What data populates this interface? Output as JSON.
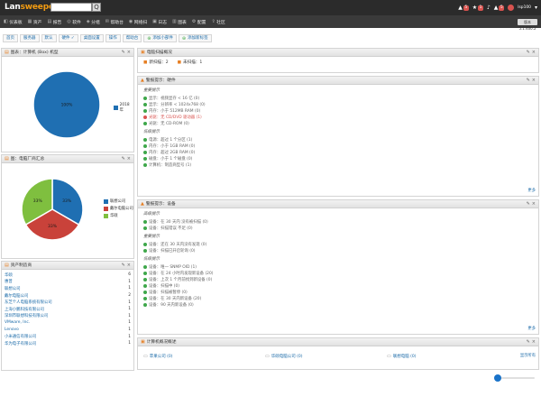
{
  "app": {
    "logo_main": "Lan",
    "logo_accent": "sweeper",
    "search_button": "Q"
  },
  "topright": {
    "items": [
      {
        "icon": "warning-icon",
        "glyph": "▲",
        "badge": "5"
      },
      {
        "icon": "star-icon",
        "glyph": "★",
        "badge": "1"
      },
      {
        "icon": "bell-icon",
        "glyph": "♪",
        "badge": ""
      },
      {
        "icon": "bell-alert-icon",
        "glyph": "▲",
        "badge": "5"
      }
    ],
    "user": "lsp100"
  },
  "nav": {
    "items": [
      {
        "icon": "dashboard-icon",
        "glyph": "◧",
        "label": "仪表板"
      },
      {
        "icon": "assets-icon",
        "glyph": "▦",
        "label": "资产"
      },
      {
        "icon": "report-icon",
        "glyph": "▤",
        "label": "报告"
      },
      {
        "icon": "software-icon",
        "glyph": "◎",
        "label": "软件"
      },
      {
        "icon": "tag-icon",
        "glyph": "◈",
        "label": "分组"
      },
      {
        "icon": "helpdesk-icon",
        "glyph": "✉",
        "label": "帮助台"
      },
      {
        "icon": "scan-icon",
        "glyph": "◉",
        "label": "网络扫"
      },
      {
        "icon": "log-icon",
        "glyph": "▣",
        "label": "日志"
      },
      {
        "icon": "chart-icon",
        "glyph": "▥",
        "label": "图表"
      },
      {
        "icon": "settings-icon",
        "glyph": "⚙",
        "label": "配置"
      },
      {
        "icon": "export-icon",
        "glyph": "⇪",
        "label": "社区"
      }
    ],
    "version": "版本 5.1.400.2"
  },
  "tabs": [
    {
      "label": "首页",
      "check": false
    },
    {
      "label": "服务器",
      "check": false
    },
    {
      "label": "默认",
      "check": false
    },
    {
      "label": "硬件 ✓",
      "check": false
    },
    {
      "label": "桌面设置",
      "check": false
    },
    {
      "label": "操作",
      "check": false
    },
    {
      "label": "帮助台",
      "check": false
    },
    {
      "label": "添加小部件",
      "check": true
    },
    {
      "label": "添加新标签",
      "check": true
    }
  ],
  "panels": {
    "pie1": {
      "title": "图表：计算机 (Box) 机型"
    },
    "pie2": {
      "title": "图：电脑厂商汇总"
    },
    "vendors": {
      "title": "资产制造商"
    },
    "summary": {
      "title": "电脑扫描概况",
      "items": [
        "新扫描：2",
        "未扫描：1"
      ]
    },
    "hw_warnings": {
      "title": "警报提示：硬件"
    },
    "dev_warnings": {
      "title": "警报提示：设备"
    },
    "computers": {
      "title": "计算机概况概述"
    }
  },
  "chart_data": [
    {
      "type": "pie",
      "series": [
        {
          "values": [
            100
          ]
        }
      ],
      "slice_labels": [
        "100%"
      ],
      "legend": [
        {
          "label": "2018 年",
          "color": "#1f6fb2"
        }
      ],
      "legend_position": "right"
    },
    {
      "type": "pie",
      "categories": [
        "联想公司",
        "戴尔电脑公司",
        "华硕"
      ],
      "series": [
        {
          "values": [
            33,
            33,
            33
          ]
        }
      ],
      "slice_labels": [
        "33%",
        "33%",
        "33%"
      ],
      "colors": [
        "#1f6fb2",
        "#c9423a",
        "#7fbf3f"
      ],
      "legend_position": "right"
    }
  ],
  "vendors": [
    {
      "name": "华硕",
      "count": "6"
    },
    {
      "name": "惠普",
      "count": "1"
    },
    {
      "name": "联想公司",
      "count": "1"
    },
    {
      "name": "戴尔电脑公司",
      "count": "2"
    },
    {
      "name": "东芝个人电脑系统有限公司",
      "count": "1"
    },
    {
      "name": "上海小鹏科技有限公司",
      "count": "1"
    },
    {
      "name": "深圳市联想科技有限公司",
      "count": "1"
    },
    {
      "name": "VMware, Inc.",
      "count": "1"
    },
    {
      "name": "Lenovo",
      "count": "1"
    },
    {
      "name": "小米通信有限公司",
      "count": "1"
    },
    {
      "name": "华为电子有限公司",
      "count": "1"
    }
  ],
  "hw": {
    "sec1": "重要提示",
    "sec1_rows": [
      {
        "status": "g",
        "text": "显示：视频显存 < 16 亿 (0)"
      },
      {
        "status": "g",
        "text": "显示：分辨率 < 1024x768 (0)"
      },
      {
        "status": "g",
        "text": "内存：小于 512MB RAM (0)"
      },
      {
        "status": "r",
        "text": "光驱：无 CD/DVD 驱动器 (1)"
      },
      {
        "status": "g",
        "text": "光驱：无 CD-ROM (0)"
      }
    ],
    "sec2": "低级提示",
    "sec2_rows": [
      {
        "status": "g",
        "text": "电源：超过 1 个分区 (1)"
      },
      {
        "status": "g",
        "text": "内存：小于 1GB RAM (0)"
      },
      {
        "status": "g",
        "text": "内存：超过 2GB RAM (0)"
      },
      {
        "status": "g",
        "text": "磁盘：小于 1 个磁盘 (0)"
      },
      {
        "status": "g",
        "text": "计算机：制造商型号 (1)"
      }
    ],
    "more": "更多"
  },
  "dev": {
    "sec1": "高级提示",
    "sec1_rows": [
      {
        "status": "g",
        "text": "设备：在 30 天内 没有被扫描 (0)"
      },
      {
        "status": "g",
        "text": "设备：扫描错误 不足 (0)"
      }
    ],
    "sec2": "重要提示",
    "sec2_rows": [
      {
        "status": "g",
        "text": "设备：还在 30 天内没有发现 (0)"
      },
      {
        "status": "g",
        "text": "设备：扫描已开启轮询 (0)"
      }
    ],
    "sec3": "低级提示",
    "sec3_rows": [
      {
        "status": "g",
        "text": "设备：唯一 SNMP OID (1)"
      },
      {
        "status": "g",
        "text": "设备：在 24 小时内发现新设备 (20)"
      },
      {
        "status": "g",
        "text": "设备：上次 1 个月前找到新设备 (0)"
      },
      {
        "status": "g",
        "text": "设备：扫描中 (0)"
      },
      {
        "status": "g",
        "text": "设备：扫描被暂停 (0)"
      },
      {
        "status": "g",
        "text": "设备：在 30 天内新设备 (20)"
      },
      {
        "status": "g",
        "text": "设备：90 天内新设备 (0)"
      }
    ],
    "more": "更多"
  },
  "computers": [
    {
      "label": "苹果公司 (0)"
    },
    {
      "label": "华硕电脑公司 (0)"
    },
    {
      "label": "联想电脑 (0)"
    }
  ],
  "computers_more": "显示所有"
}
